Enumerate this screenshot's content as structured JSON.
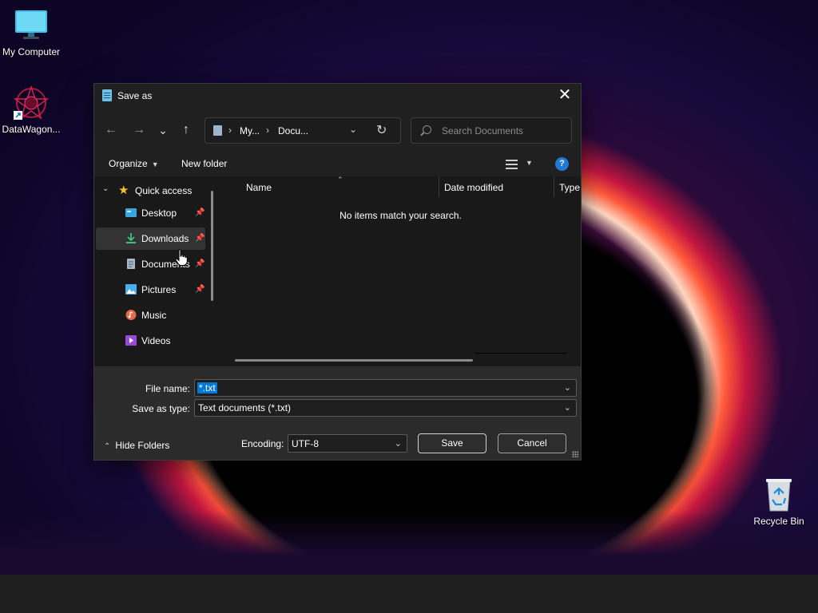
{
  "desktop": {
    "icons": [
      {
        "label": "My Computer",
        "icon": "monitor-icon"
      },
      {
        "label": "DataWagon...",
        "icon": "app-shortcut-icon"
      },
      {
        "label": "Recycle Bin",
        "icon": "recycle-bin-icon"
      }
    ]
  },
  "dialog": {
    "title": "Save as",
    "close_label": "✕",
    "nav": {
      "back": "←",
      "forward": "→",
      "recent": "⌄",
      "up": "↑"
    },
    "address": {
      "parts": [
        "My...",
        "Docu..."
      ],
      "separator": "›"
    },
    "search": {
      "placeholder": "Search Documents"
    },
    "toolbar": {
      "organize": "Organize",
      "new_folder": "New folder",
      "help": "?"
    },
    "navpane": {
      "quick_access": "Quick access",
      "items": [
        {
          "label": "Desktop",
          "icon": "desktop-folder-icon",
          "pinned": true
        },
        {
          "label": "Downloads",
          "icon": "downloads-icon",
          "pinned": true,
          "selected": true
        },
        {
          "label": "Documents",
          "icon": "documents-icon",
          "pinned": true
        },
        {
          "label": "Pictures",
          "icon": "pictures-icon",
          "pinned": true
        },
        {
          "label": "Music",
          "icon": "music-icon",
          "pinned": false
        },
        {
          "label": "Videos",
          "icon": "videos-icon",
          "pinned": false
        }
      ]
    },
    "filelist": {
      "columns": [
        "Name",
        "Date modified",
        "Type"
      ],
      "empty_message": "No items match your search."
    },
    "bottom": {
      "file_name_label": "File name:",
      "file_name_value": "*.txt",
      "save_type_label": "Save as type:",
      "save_type_value": "Text documents (*.txt)",
      "hide_folders": "Hide Folders",
      "encoding_label": "Encoding:",
      "encoding_value": "UTF-8",
      "save": "Save",
      "cancel": "Cancel"
    }
  },
  "colors": {
    "accent": "#0078d7",
    "dialog_bg": "#191919",
    "panel_bg": "#2b2b2b"
  }
}
